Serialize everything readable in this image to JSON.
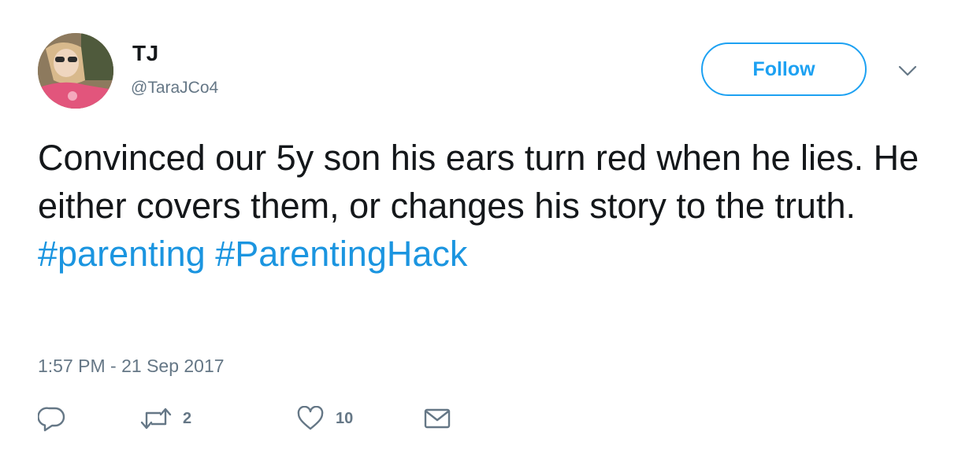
{
  "author": {
    "display_name": "TJ",
    "handle": "@TaraJCo4"
  },
  "header": {
    "follow_label": "Follow"
  },
  "tweet": {
    "text_plain": "Convinced our 5y son his ears turn red when he lies. He either covers them, or changes his story to the truth.",
    "hashtags": [
      "#parenting",
      "#ParentingHack"
    ],
    "timestamp": "1:57 PM - 21 Sep 2017"
  },
  "actions": {
    "reply_icon": "reply-icon",
    "retweet_icon": "retweet-icon",
    "retweet_count": "2",
    "like_icon": "heart-icon",
    "like_count": "10",
    "dm_icon": "envelope-icon"
  },
  "colors": {
    "accent": "#1da1f2",
    "hashtag": "#1b95e0",
    "text": "#14171a",
    "secondary": "#657786"
  }
}
